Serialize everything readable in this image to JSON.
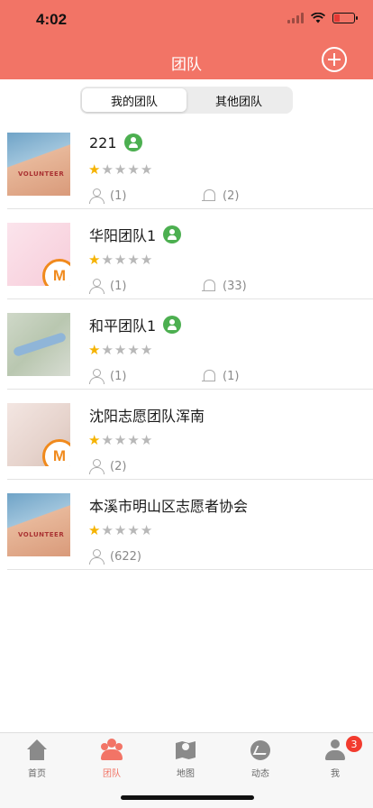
{
  "status_bar": {
    "time": "4:02"
  },
  "header": {
    "title": "团队"
  },
  "segment": {
    "tabs": [
      "我的团队",
      "其他团队"
    ],
    "selected": 0
  },
  "teams": [
    {
      "name": "221",
      "verified": true,
      "rating": 1,
      "rating_max": 5,
      "members": "(1)",
      "notices": "(2)",
      "thumb": "volunteer-hand"
    },
    {
      "name": "华阳团队1",
      "verified": true,
      "rating": 1,
      "rating_max": 5,
      "members": "(1)",
      "notices": "(33)",
      "thumb": "pink-heart-with-logo"
    },
    {
      "name": "和平团队1",
      "verified": true,
      "rating": 1,
      "rating_max": 5,
      "members": "(1)",
      "notices": "(1)",
      "thumb": "map"
    },
    {
      "name": "沈阳志愿团队浑南",
      "verified": false,
      "rating": 1,
      "rating_max": 5,
      "members": "(2)",
      "notices": null,
      "thumb": "flower-with-logo"
    },
    {
      "name": "本溪市明山区志愿者协会",
      "verified": false,
      "rating": 1,
      "rating_max": 5,
      "members": "(622)",
      "notices": null,
      "thumb": "volunteer-hand"
    }
  ],
  "tabbar": {
    "items": [
      {
        "label": "首页",
        "icon": "home-icon"
      },
      {
        "label": "团队",
        "icon": "team-icon",
        "active": true
      },
      {
        "label": "地图",
        "icon": "map-icon"
      },
      {
        "label": "动态",
        "icon": "activity-icon"
      },
      {
        "label": "我",
        "icon": "profile-icon",
        "badge": "3"
      }
    ]
  },
  "colors": {
    "accent": "#F27466",
    "verified": "#4CAF50",
    "star": "#F5B301",
    "badge": "#F23B2E",
    "logo": "#F08A1D"
  }
}
